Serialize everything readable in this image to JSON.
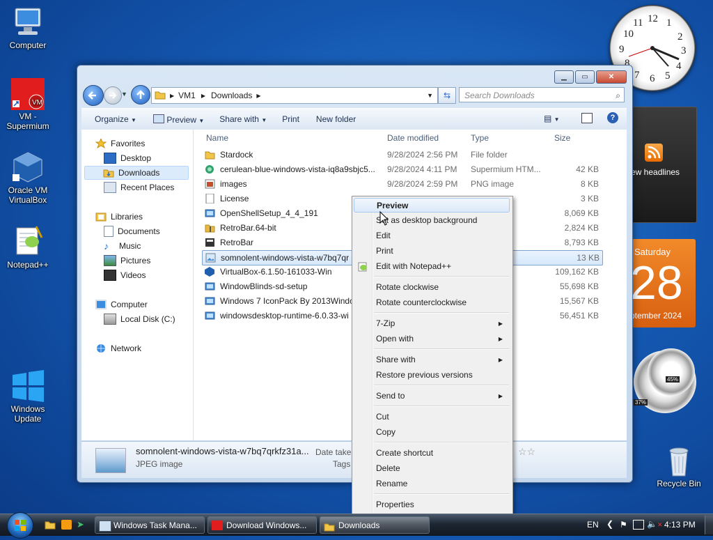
{
  "desktop": {
    "icons": [
      {
        "label": "Computer"
      },
      {
        "label": "VM - Supermium"
      },
      {
        "label": "Oracle VM VirtualBox"
      },
      {
        "label": "Notepad++"
      },
      {
        "label": "Windows Update"
      },
      {
        "label": "Recycle Bin"
      }
    ]
  },
  "explorer": {
    "breadcrumb": [
      "VM1",
      "Downloads"
    ],
    "search_placeholder": "Search Downloads",
    "toolbar": {
      "organize": "Organize",
      "preview": "Preview",
      "share_with": "Share with",
      "print": "Print",
      "new_folder": "New folder"
    },
    "nav": {
      "favorites": "Favorites",
      "desktop": "Desktop",
      "downloads": "Downloads",
      "recent": "Recent Places",
      "libraries": "Libraries",
      "documents": "Documents",
      "music": "Music",
      "pictures": "Pictures",
      "videos": "Videos",
      "computer": "Computer",
      "local_disk": "Local Disk (C:)",
      "network": "Network"
    },
    "columns": {
      "name": "Name",
      "date": "Date modified",
      "type": "Type",
      "size": "Size"
    },
    "files": [
      {
        "name": "Stardock",
        "date": "9/28/2024 2:56 PM",
        "type": "File folder",
        "size": "",
        "icon": "folder-icon"
      },
      {
        "name": "cerulean-blue-windows-vista-iq8a9sbjc5...",
        "date": "9/28/2024 4:11 PM",
        "type": "Supermium HTM...",
        "size": "42 KB",
        "icon": "html-file-icon"
      },
      {
        "name": "images",
        "date": "9/28/2024 2:59 PM",
        "type": "PNG image",
        "size": "8 KB",
        "icon": "png-image-icon"
      },
      {
        "name": "License",
        "date": "",
        "type": "ent",
        "size": "3 KB",
        "icon": "text-file-icon"
      },
      {
        "name": "OpenShellSetup_4_4_191",
        "date": "",
        "type": "",
        "size": "8,069 KB",
        "icon": "installer-icon"
      },
      {
        "name": "RetroBar.64-bit",
        "date": "",
        "type": "d (zipp...",
        "size": "2,824 KB",
        "icon": "zip-folder-icon"
      },
      {
        "name": "RetroBar",
        "date": "",
        "type": "",
        "size": "8,793 KB",
        "icon": "app-icon"
      },
      {
        "name": "somnolent-windows-vista-w7bq7qr",
        "date": "",
        "type": "",
        "size": "13 KB",
        "icon": "jpeg-image-icon"
      },
      {
        "name": "VirtualBox-6.1.50-161033-Win",
        "date": "",
        "type": "",
        "size": "109,162 KB",
        "icon": "virtualbox-icon"
      },
      {
        "name": "WindowBlinds-sd-setup",
        "date": "",
        "type": "",
        "size": "55,698 KB",
        "icon": "installer-icon"
      },
      {
        "name": "Windows 7 IconPack By 2013Window",
        "date": "",
        "type": "",
        "size": "15,567 KB",
        "icon": "installer-icon"
      },
      {
        "name": "windowsdesktop-runtime-6.0.33-wi",
        "date": "",
        "type": "",
        "size": "56,451 KB",
        "icon": "installer-icon"
      }
    ],
    "details": {
      "filename": "somnolent-windows-vista-w7bq7qrkfz31a...",
      "filetype": "JPEG image",
      "date_taken_label": "Date taken",
      "tags_label": "Tags"
    }
  },
  "context_menu": {
    "items": [
      {
        "label": "Preview",
        "bold": true
      },
      {
        "label": "Set as desktop background"
      },
      {
        "label": "Edit"
      },
      {
        "label": "Print"
      },
      {
        "label": "Edit with Notepad++"
      },
      {
        "label": "Rotate clockwise"
      },
      {
        "label": "Rotate counterclockwise"
      },
      {
        "label": "7-Zip",
        "submenu": true
      },
      {
        "label": "Open with",
        "submenu": true
      },
      {
        "label": "Share with",
        "submenu": true
      },
      {
        "label": "Restore previous versions"
      },
      {
        "label": "Send to",
        "submenu": true
      },
      {
        "label": "Cut"
      },
      {
        "label": "Copy"
      },
      {
        "label": "Create shortcut"
      },
      {
        "label": "Delete"
      },
      {
        "label": "Rename"
      },
      {
        "label": "Properties"
      }
    ]
  },
  "gadgets": {
    "clock_numbers": [
      "12",
      "1",
      "2",
      "3",
      "4",
      "5",
      "6",
      "7",
      "8",
      "9",
      "10",
      "11"
    ],
    "feed_label": "ew headlines",
    "calendar": {
      "weekday": "Saturday",
      "day": "28",
      "month_year": "ptember 2024"
    },
    "meters": {
      "cpu": "45%",
      "mem": "37%"
    }
  },
  "taskbar": {
    "tasks": [
      "Windows Task Mana...",
      "Download Windows...",
      "Downloads"
    ],
    "language": "EN",
    "time": "4:13 PM"
  }
}
